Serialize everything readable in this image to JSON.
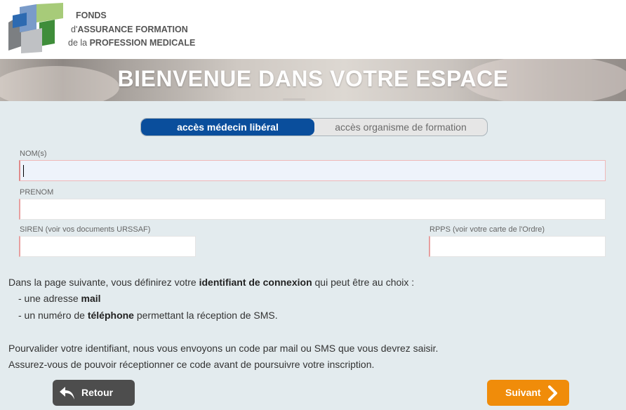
{
  "brand": {
    "line1": "FONDS",
    "line2_prefix": "d'",
    "line2_bold": "ASSURANCE FORMATION",
    "line3_prefix": "de la ",
    "line3_bold": "PROFESSION MEDICALE"
  },
  "hero": {
    "title": "BIENVENUE DANS VOTRE ESPACE"
  },
  "access_toggle": {
    "active_label": "accès médecin libéral",
    "inactive_label": "accès organisme de formation"
  },
  "form": {
    "nom_label": "NOM(s)",
    "nom_value": "",
    "prenom_label": "PRENOM",
    "prenom_value": "",
    "siren_label": "SIREN (voir vos documents URSSAF)",
    "siren_value": "",
    "rpps_label": "RPPS (voir votre carte de l'Ordre)",
    "rpps_value": ""
  },
  "info": {
    "line1_a": "Dans la page suivante, vous définirez votre ",
    "line1_b": "identifiant de connexion",
    "line1_c": " qui peut être au choix :",
    "item1_a": "- une adresse ",
    "item1_b": "mail",
    "item2_a": "- un numéro de ",
    "item2_b": "téléphone",
    "item2_c": " permettant la réception de SMS.",
    "para2_line1": "Pourvalider votre identifiant, nous vous envoyons un code par mail ou SMS que vous devrez saisir.",
    "para2_line2": "Assurez-vous de pouvoir réceptionner ce code avant de poursuivre votre inscription."
  },
  "buttons": {
    "back_label": "Retour",
    "next_label": "Suivant"
  },
  "colors": {
    "primary_blue": "#0a4e9c",
    "next_orange": "#f08c0a",
    "back_gray": "#4d4d4d",
    "page_bg": "#e3ebee"
  },
  "icons": {
    "back": "back-arrow-icon",
    "next": "chevron-right-icon",
    "logo": "fafpm-logo"
  }
}
